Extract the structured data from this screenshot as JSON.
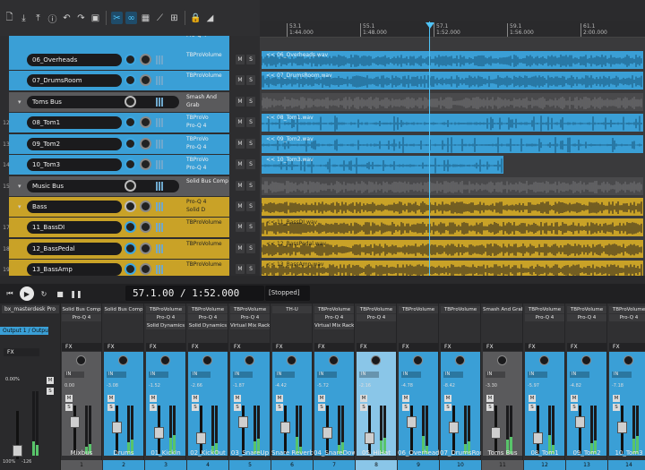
{
  "colors": {
    "blue": "#3a9fd6",
    "gray": "#5a5a5c",
    "yellow": "#c9a227",
    "accent": "#4fc3f7"
  },
  "toolbar": {
    "icons": [
      "new-file-icon",
      "import-icon",
      "export-icon",
      "info-icon",
      "undo-icon",
      "redo-icon",
      "save-icon",
      "cut-tool-icon",
      "loop-icon",
      "grid-icon",
      "envelope-icon",
      "snap-icon",
      "lock-icon",
      "knife-icon"
    ]
  },
  "ruler": {
    "marks": [
      {
        "bar": "53.1",
        "time": "1:44.000"
      },
      {
        "bar": "55.1",
        "time": "1:48.000"
      },
      {
        "bar": "57.1",
        "time": "1:52.000"
      },
      {
        "bar": "59.1",
        "time": "1:56.000"
      },
      {
        "bar": "61.1",
        "time": "2:00.000"
      }
    ]
  },
  "tracks": [
    {
      "num": "",
      "name": "",
      "color": "blue",
      "insert": "Pro-Q 4",
      "partial": true,
      "clip": ""
    },
    {
      "num": "",
      "name": "06_Overheads",
      "color": "blue",
      "insert": "TBProVolume",
      "clip": "<< 06_Overheads.wav"
    },
    {
      "num": "",
      "name": "07_DrumsRoom",
      "color": "blue",
      "insert": "TBProVolume",
      "clip": "<< 07_DrumsRoom.wav"
    },
    {
      "num": "",
      "name": "Toms Bus",
      "color": "gray",
      "insert": "Smash And Grab",
      "clip": ""
    },
    {
      "num": "12",
      "name": "08_Tom1",
      "color": "blue",
      "insert": "TBProVo",
      "insert2": "Pro-Q 4",
      "clip": "<< 08_Tom1.wav"
    },
    {
      "num": "13",
      "name": "09_Tom2",
      "color": "blue",
      "insert": "TBProVo",
      "insert2": "Pro-Q 4",
      "clip": "<< 09_Tom2.wav"
    },
    {
      "num": "14",
      "name": "10_Tom3",
      "color": "blue",
      "insert": "TBProVo",
      "insert2": "Pro-Q 4",
      "clip": "<< 10_Tom3.wav"
    },
    {
      "num": "15",
      "name": "Music Bus",
      "color": "gray",
      "insert": "Solid Bus Comp",
      "clip": ""
    },
    {
      "num": "",
      "name": "Bass",
      "color": "yellow",
      "insert": "Pro-Q 4",
      "insert2": "Solid D",
      "clip": ""
    },
    {
      "num": "17",
      "name": "11_BassDI",
      "color": "yellow",
      "insert": "TBProVolume",
      "clip": "<< 11_BassDI.wav"
    },
    {
      "num": "18",
      "name": "12_BassPedal",
      "color": "yellow",
      "insert": "TBProVolume",
      "clip": "<< 12_BassPedal.wav"
    },
    {
      "num": "19",
      "name": "13_BassAmp",
      "color": "yellow",
      "insert": "TBProVolume",
      "clip": "<< 13_BassAmp.wav"
    }
  ],
  "transport": {
    "position": "57.1.00 / 1:52.000",
    "status": "[Stopped]"
  },
  "master": {
    "slot": "bx_masterdesk Pro",
    "output": "Output 1 / Output",
    "fx": "FX",
    "db": "0.00%",
    "num": "100%",
    "num2": "-126"
  },
  "strips": [
    {
      "name": "Mixbus",
      "num": "1",
      "color": "#5a5a5c",
      "ins": [
        "Solid Bus Comp",
        "Pro-Q 4",
        ""
      ],
      "db": "0.00"
    },
    {
      "name": "Drums",
      "num": "2",
      "color": "#3a9fd6",
      "ins": [
        "Solid Bus Comp",
        "",
        ""
      ],
      "db": "-3.08"
    },
    {
      "name": "01_KickIn",
      "num": "3",
      "color": "#3a9fd6",
      "ins": [
        "TBProVolume",
        "Pro-Q 4",
        "Solid Dynamics"
      ],
      "db": "-1.52"
    },
    {
      "name": "02_KickOut",
      "num": "4",
      "color": "#3a9fd6",
      "ins": [
        "TBProVolume",
        "Pro-Q 4",
        "Solid Dynamics"
      ],
      "db": "-2.66"
    },
    {
      "name": "03_SnareUp",
      "num": "5",
      "color": "#3a9fd6",
      "ins": [
        "TBProVolume",
        "Pro-Q 4",
        "Virtual Mix Rack"
      ],
      "db": "-1.87"
    },
    {
      "name": "Snare Reverb",
      "num": "6",
      "color": "#3a9fd6",
      "ins": [
        "TH-U",
        "",
        ""
      ],
      "db": "-4.42"
    },
    {
      "name": "04_SnareDown",
      "num": "7",
      "color": "#3a9fd6",
      "ins": [
        "TBProVolume",
        "Pro-Q 4",
        "Virtual Mix Rack"
      ],
      "db": "-5.72"
    },
    {
      "name": "05_HiHat",
      "num": "8",
      "color": "#8ac6e8",
      "ins": [
        "TBProVolume",
        "Pro-Q 4",
        ""
      ],
      "db": "-2.16"
    },
    {
      "name": "06_Overheads",
      "num": "9",
      "color": "#3a9fd6",
      "ins": [
        "TBProVolume",
        "",
        ""
      ],
      "db": "-4.78"
    },
    {
      "name": "07_DrumsRoom",
      "num": "10",
      "color": "#3a9fd6",
      "ins": [
        "TBProVolume",
        "",
        ""
      ],
      "db": "-8.42"
    },
    {
      "name": "Toms Bus",
      "num": "11",
      "color": "#5a5a5c",
      "ins": [
        "Smash And Grab",
        "",
        ""
      ],
      "db": "-3.30"
    },
    {
      "name": "08_Tom1",
      "num": "12",
      "color": "#3a9fd6",
      "ins": [
        "TBProVolume",
        "Pro-Q 4",
        ""
      ],
      "db": "-5.97"
    },
    {
      "name": "09_Tom2",
      "num": "13",
      "color": "#3a9fd6",
      "ins": [
        "TBProVolume",
        "Pro-Q 4",
        ""
      ],
      "db": "-4.82"
    },
    {
      "name": "10_Tom3",
      "num": "14",
      "color": "#3a9fd6",
      "ins": [
        "TBProVolume",
        "Pro-Q 4",
        ""
      ],
      "db": "-7.18"
    }
  ]
}
